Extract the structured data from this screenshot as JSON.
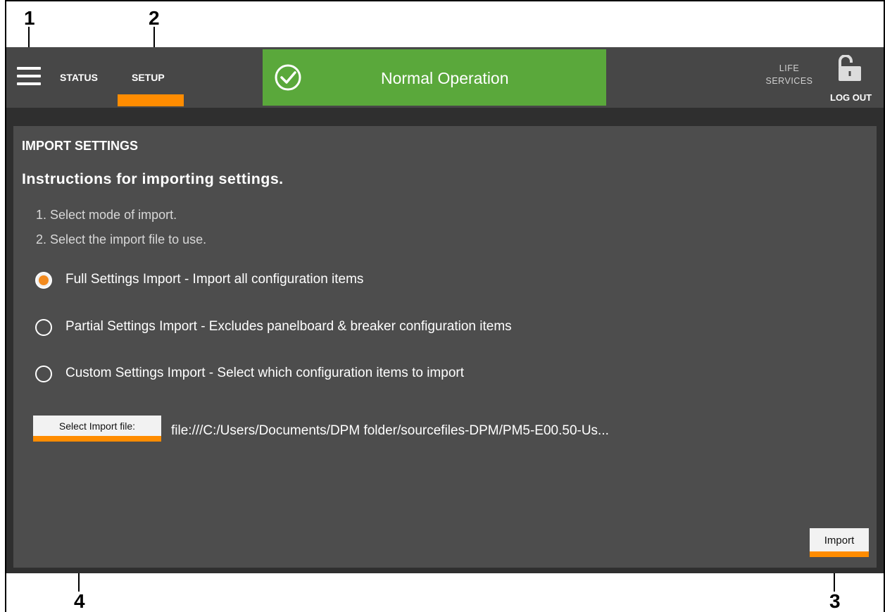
{
  "callouts": [
    "1",
    "2",
    "3",
    "4"
  ],
  "nav": {
    "menu_icon": "hamburger-menu-icon",
    "status_label": "STATUS",
    "setup_label": "SETUP"
  },
  "status_banner": {
    "text": "Normal Operation",
    "icon": "check-circle-icon",
    "color": "#5aa83b"
  },
  "header_right": {
    "life_services_line1": "LIFE",
    "life_services_line2": "SERVICES",
    "lock_icon": "unlocked-padlock-icon",
    "logout_label": "LOG OUT"
  },
  "page": {
    "section_title": "IMPORT SETTINGS",
    "instructions_heading": "Instructions for importing settings.",
    "steps": [
      "1. Select mode of import.",
      "2. Select the import file to use."
    ],
    "import_modes": [
      {
        "label": "Full Settings Import - Import all configuration items",
        "selected": true
      },
      {
        "label": "Partial Settings Import - Excludes panelboard & breaker configuration items",
        "selected": false
      },
      {
        "label": "Custom Settings Import - Select which configuration items to import",
        "selected": false
      }
    ],
    "select_file_button": "Select Import file:",
    "file_path": "file:///C:/Users/Documents/DPM folder/sourcefiles-DPM/PM5-E00.50-Us...",
    "import_button": "Import"
  },
  "colors": {
    "accent": "#ff8c00",
    "header_bg": "#474747",
    "content_bg": "#4d4d4d",
    "status_green": "#5aa83b"
  }
}
